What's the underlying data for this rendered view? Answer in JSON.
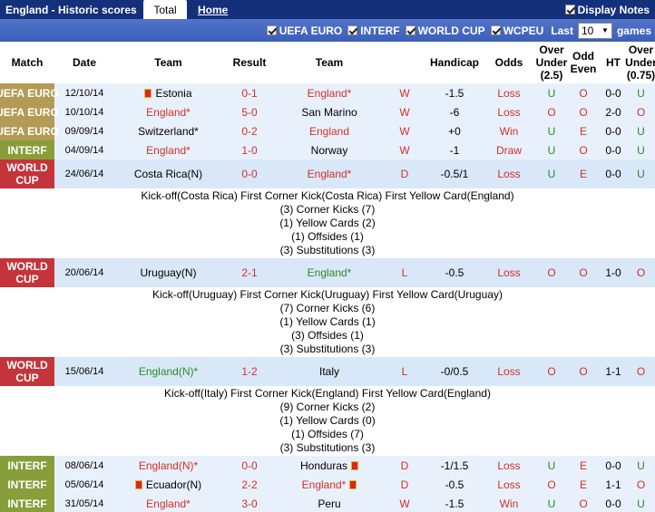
{
  "header": {
    "title": "England - Historic scores",
    "tab_total": "Total",
    "tab_home": "Home",
    "display_notes": "Display Notes"
  },
  "filters": {
    "euro": "UEFA EURO",
    "interf": "INTERF",
    "worldcup": "WORLD CUP",
    "wcpeu": "WCPEU",
    "last_label": "Last",
    "last_value": "10",
    "games_label": "games"
  },
  "columns": {
    "match": "Match",
    "date": "Date",
    "team1": "Team",
    "result": "Result",
    "team2": "Team",
    "handicap": "Handicap",
    "odds": "Odds",
    "over_under": "Over\nUnder\n(2.5)",
    "odd_even": "Odd\nEven",
    "ht": "HT",
    "over_under2": "Over\nUnder\n(0.75)"
  },
  "rows": [
    {
      "match": "UEFA EURO",
      "date": "12/10/14",
      "home": "Estonia",
      "result": "0-1",
      "away": "England*",
      "wl": "W",
      "hcap": "-1.5",
      "odds": "Loss",
      "ou": "U",
      "oe": "O",
      "ht": "0-0",
      "ou2": "U"
    },
    {
      "match": "UEFA EURO",
      "date": "10/10/14",
      "home": "England*",
      "result": "5-0",
      "away": "San Marino",
      "wl": "W",
      "hcap": "-6",
      "odds": "Loss",
      "ou": "O",
      "oe": "O",
      "ht": "2-0",
      "ou2": "O"
    },
    {
      "match": "UEFA EURO",
      "date": "09/09/14",
      "home": "Switzerland*",
      "result": "0-2",
      "away": "England",
      "wl": "W",
      "hcap": "+0",
      "odds": "Win",
      "ou": "U",
      "oe": "E",
      "ht": "0-0",
      "ou2": "U"
    },
    {
      "match": "INTERF",
      "date": "04/09/14",
      "home": "England*",
      "result": "1-0",
      "away": "Norway",
      "wl": "W",
      "hcap": "-1",
      "odds": "Draw",
      "ou": "U",
      "oe": "O",
      "ht": "0-0",
      "ou2": "U"
    },
    {
      "match": "WORLD CUP",
      "date": "24/06/14",
      "home": "Costa Rica(N)",
      "result": "0-0",
      "away": "England*",
      "wl": "D",
      "hcap": "-0.5/1",
      "odds": "Loss",
      "ou": "U",
      "oe": "E",
      "ht": "0-0",
      "ou2": "U",
      "detail": {
        "line": "Kick-off(Costa Rica)   First Corner Kick(Costa Rica)   First Yellow Card(England)",
        "stats": [
          "(3) Corner Kicks (7)",
          "(1) Yellow Cards (2)",
          "(1) Offsides (1)",
          "(3) Substitutions (3)"
        ]
      }
    },
    {
      "match": "WORLD CUP",
      "date": "20/06/14",
      "home": "Uruguay(N)",
      "result": "2-1",
      "away": "England*",
      "wl": "L",
      "hcap": "-0.5",
      "odds": "Loss",
      "ou": "O",
      "oe": "O",
      "ht": "1-0",
      "ou2": "O",
      "detail": {
        "line": "Kick-off(Uruguay)   First Corner Kick(Uruguay)   First Yellow Card(Uruguay)",
        "stats": [
          "(7) Corner Kicks (6)",
          "(1) Yellow Cards (1)",
          "(3) Offsides (1)",
          "(3) Substitutions (3)"
        ]
      }
    },
    {
      "match": "WORLD CUP",
      "date": "15/06/14",
      "home": "England(N)*",
      "result": "1-2",
      "away": "Italy",
      "wl": "L",
      "hcap": "-0/0.5",
      "odds": "Loss",
      "ou": "O",
      "oe": "O",
      "ht": "1-1",
      "ou2": "O",
      "detail": {
        "line": "Kick-off(Italy)   First Corner Kick(England)   First Yellow Card(England)",
        "stats": [
          "(9) Corner Kicks (2)",
          "(1) Yellow Cards (0)",
          "(1) Offsides (7)",
          "(3) Substitutions (3)"
        ]
      }
    },
    {
      "match": "INTERF",
      "date": "08/06/14",
      "home": "England(N)*",
      "result": "0-0",
      "away": "Honduras",
      "wl": "D",
      "hcap": "-1/1.5",
      "odds": "Loss",
      "ou": "U",
      "oe": "E",
      "ht": "0-0",
      "ou2": "U"
    },
    {
      "match": "INTERF",
      "date": "05/06/14",
      "home": "Ecuador(N)",
      "result": "2-2",
      "away": "England*",
      "wl": "D",
      "hcap": "-0.5",
      "odds": "Loss",
      "ou": "O",
      "oe": "E",
      "ht": "1-1",
      "ou2": "O"
    },
    {
      "match": "INTERF",
      "date": "31/05/14",
      "home": "England*",
      "result": "3-0",
      "away": "Peru",
      "wl": "W",
      "hcap": "-1.5",
      "odds": "Win",
      "ou": "U",
      "oe": "O",
      "ht": "0-0",
      "ou2": "U"
    }
  ]
}
